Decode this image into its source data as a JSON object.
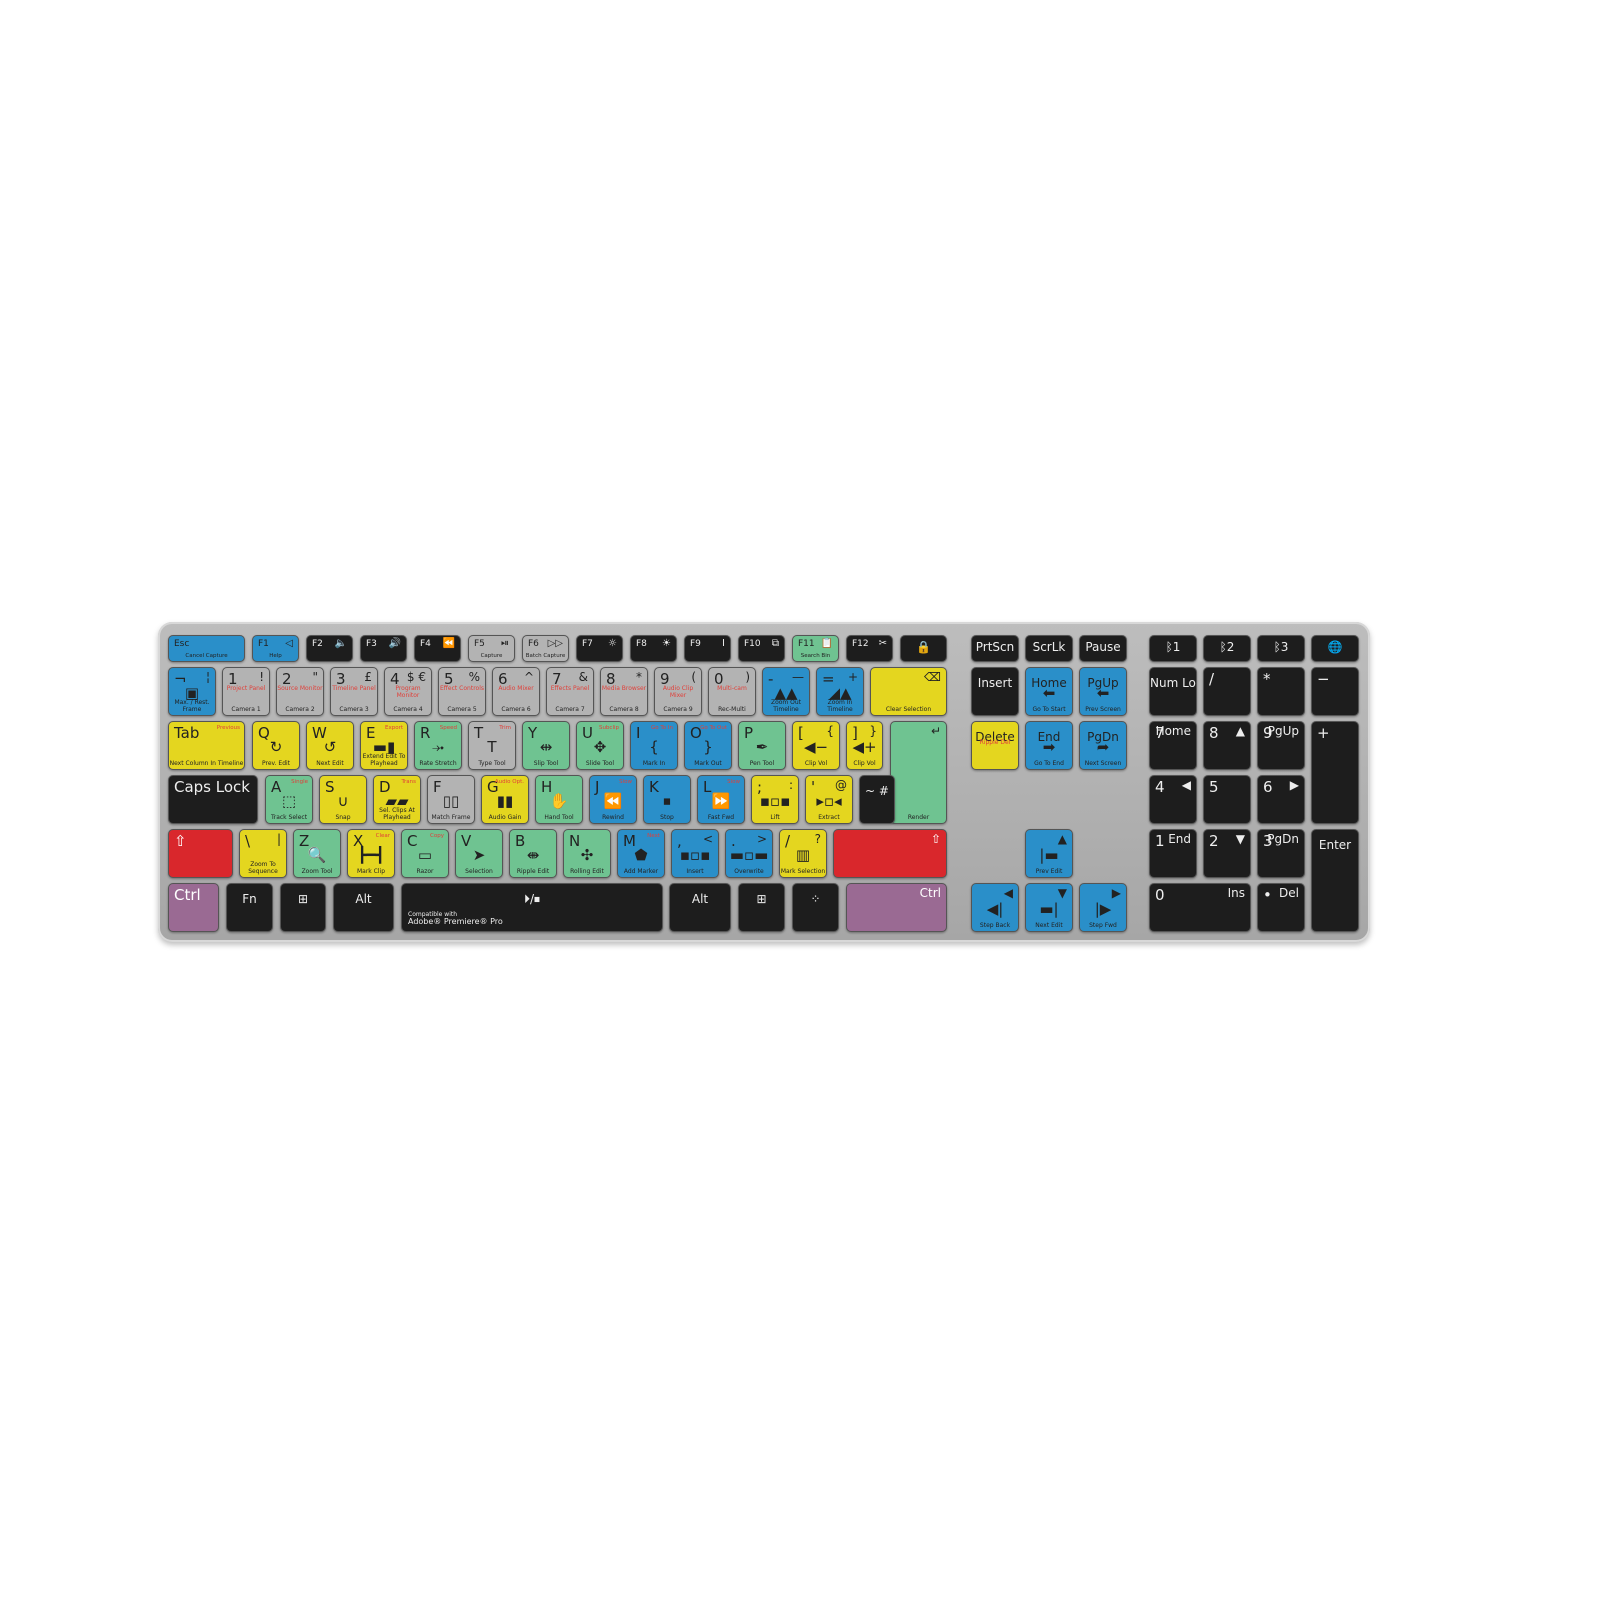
{
  "product": {
    "compat_line1": "Compatible with",
    "compat_line2": "Adobe® Premiere® Pro"
  },
  "colors": {
    "blue": "#2a8fc9",
    "yellow": "#e4d61f",
    "green": "#6fc391",
    "gray": "#b3b3b3",
    "black": "#1d1d1d",
    "red": "#d9272c",
    "purple": "#9a6a93",
    "sublabel": "#e0403a"
  },
  "keys": [
    {
      "t": "Esc",
      "b": "Cancel Capture",
      "c": "blue"
    },
    {
      "t": "F1",
      "s": "◁",
      "b": "Help",
      "c": "blue"
    },
    {
      "t": "F2",
      "s": "🔈",
      "c": "black"
    },
    {
      "t": "F3",
      "s": "🔊",
      "c": "black"
    },
    {
      "t": "F4",
      "s": "⏪",
      "c": "black"
    },
    {
      "t": "F5",
      "s": "⏯",
      "b": "Capture",
      "c": "gray"
    },
    {
      "t": "F6",
      "s": "▷▷",
      "b": "Batch Capture",
      "c": "gray"
    },
    {
      "t": "F7",
      "s": "☼",
      "c": "black"
    },
    {
      "t": "F8",
      "s": "☀",
      "c": "black"
    },
    {
      "t": "F9",
      "s": "I",
      "c": "black"
    },
    {
      "t": "F10",
      "s": "⧉",
      "c": "black"
    },
    {
      "t": "F11",
      "s": "📋",
      "b": "Search Bin",
      "c": "green"
    },
    {
      "t": "F12",
      "s": "✂",
      "c": "black"
    },
    {
      "t": "🔒",
      "c": "black",
      "center": true
    },
    {
      "t": "PrtScn",
      "c": "black",
      "center": true
    },
    {
      "t": "ScrLk",
      "c": "black",
      "center": true
    },
    {
      "t": "Pause",
      "c": "black",
      "center": true
    },
    {
      "t": "ᛒ1",
      "c": "black",
      "center": true
    },
    {
      "t": "ᛒ2",
      "c": "black",
      "center": true
    },
    {
      "t": "ᛒ3",
      "c": "black",
      "center": true
    },
    {
      "t": "🌐",
      "c": "black",
      "center": true
    },
    {
      "t": "¬",
      "s": "¦",
      "i": "▣",
      "b": "Max. / Rest. Frame",
      "c": "blue"
    },
    {
      "t": "1",
      "s": "!",
      "r": "Project Panel",
      "b": "Camera 1",
      "c": "gray"
    },
    {
      "t": "2",
      "s": "\"",
      "r": "Source Monitor",
      "b": "Camera 2",
      "c": "gray"
    },
    {
      "t": "3",
      "s": "£",
      "r": "Timeline Panel",
      "b": "Camera 3",
      "c": "gray"
    },
    {
      "t": "4",
      "s": "$ €",
      "r": "Program Monitor",
      "b": "Camera 4",
      "c": "gray"
    },
    {
      "t": "5",
      "s": "%",
      "r": "Effect Controls",
      "b": "Camera 5",
      "c": "gray"
    },
    {
      "t": "6",
      "s": "^",
      "r": "Audio Mixer",
      "b": "Camera 6",
      "c": "gray"
    },
    {
      "t": "7",
      "s": "&",
      "r": "Effects Panel",
      "b": "Camera 7",
      "c": "gray"
    },
    {
      "t": "8",
      "s": "*",
      "r": "Media Browser",
      "b": "Camera 8",
      "c": "gray"
    },
    {
      "t": "9",
      "s": "(",
      "r": "Audio Clip Mixer",
      "b": "Camera 9",
      "c": "gray"
    },
    {
      "t": "0",
      "s": ")",
      "r": "Multi-cam",
      "b": "Rec-Multi",
      "c": "gray"
    },
    {
      "t": "-",
      "s": "—",
      "i": "▲▲",
      "b": "Zoom Out Timeline",
      "c": "blue"
    },
    {
      "t": "=",
      "s": "+",
      "i": "◢▲",
      "b": "Zoom In Timeline",
      "c": "blue"
    },
    {
      "s": "⌫",
      "b": "Clear  Selection",
      "c": "yellow"
    },
    {
      "t": "Insert",
      "c": "black",
      "center": true
    },
    {
      "t": "Home",
      "i": "⬅",
      "b": "Go To Start",
      "c": "blue",
      "center": true
    },
    {
      "t": "PgUp",
      "i": "⬅",
      "b": "Prev Screen",
      "c": "blue",
      "center": true
    },
    {
      "t": "Num Lock",
      "c": "black",
      "center": true
    },
    {
      "t": "/",
      "c": "black"
    },
    {
      "t": "*",
      "c": "black"
    },
    {
      "t": "−",
      "c": "black"
    },
    {
      "t": "Tab",
      "rt": "Previous",
      "b": "Next Column In Timeline",
      "c": "yellow"
    },
    {
      "t": "Q",
      "i": "↻",
      "b": "Prev. Edit",
      "c": "yellow"
    },
    {
      "t": "W",
      "i": "↺",
      "b": "Next Edit",
      "c": "yellow"
    },
    {
      "t": "E",
      "rt": "Export",
      "i": "▬▮",
      "b": "Extend Edit To Playhead",
      "c": "yellow"
    },
    {
      "t": "R",
      "rt": "Speed",
      "i": "⤞",
      "b": "Rate Stretch",
      "c": "green"
    },
    {
      "t": "T",
      "rt": "Trim",
      "i": "T",
      "b": "Type Tool",
      "c": "gray"
    },
    {
      "t": "Y",
      "i": "⇹",
      "b": "Slip Tool",
      "c": "green"
    },
    {
      "t": "U",
      "rt": "Subclip",
      "i": "✥",
      "b": "Slide Tool",
      "c": "green"
    },
    {
      "t": "I",
      "rt": "Go To In",
      "i": "{",
      "b": "Mark In",
      "c": "blue"
    },
    {
      "t": "O",
      "rt": "Go To Out",
      "i": "}",
      "b": "Mark Out",
      "c": "blue"
    },
    {
      "t": "P",
      "i": "✒",
      "b": "Pen Tool",
      "c": "green"
    },
    {
      "t": "[",
      "s": "{",
      "i": "◀−",
      "b": "Clip Vol",
      "c": "yellow"
    },
    {
      "t": "]",
      "s": "}",
      "i": "◀+",
      "b": "Clip Vol",
      "c": "yellow"
    },
    {
      "s": "↵",
      "b": "Render",
      "c": "green"
    },
    {
      "t": "Delete",
      "r": "Ripple Del",
      "c": "yellow",
      "center": true
    },
    {
      "t": "End",
      "i": "➡",
      "b": "Go To End",
      "c": "blue",
      "center": true
    },
    {
      "t": "PgDn",
      "i": "➦",
      "b": "Next Screen",
      "c": "blue",
      "center": true
    },
    {
      "t": "7",
      "s": "Home",
      "c": "black"
    },
    {
      "t": "8",
      "s": "▲",
      "c": "black"
    },
    {
      "t": "9",
      "s": "PgUp",
      "c": "black"
    },
    {
      "t": "+",
      "c": "black"
    },
    {
      "t": "Caps Lock",
      "c": "black"
    },
    {
      "t": "A",
      "rt": "Single",
      "i": "⬚",
      "b": "Track Select",
      "c": "green"
    },
    {
      "t": "S",
      "i": "∪",
      "b": "Snap",
      "c": "yellow"
    },
    {
      "t": "D",
      "rt": "Trans",
      "i": "▰▰",
      "b": "Sel. Clips At Playhead",
      "c": "yellow"
    },
    {
      "t": "F",
      "i": "▯▯",
      "b": "Match Frame",
      "c": "gray"
    },
    {
      "t": "G",
      "rt": "Audio Opt.",
      "i": "▮▮",
      "b": "Audio Gain",
      "c": "yellow"
    },
    {
      "t": "H",
      "i": "✋",
      "b": "Hand Tool",
      "c": "green"
    },
    {
      "t": "J",
      "rt": "Slow",
      "i": "⏪",
      "b": "Rewind",
      "c": "blue"
    },
    {
      "t": "K",
      "i": "⏹",
      "b": "Stop",
      "c": "blue"
    },
    {
      "t": "L",
      "rt": "Slow",
      "i": "⏩",
      "b": "Fast Fwd",
      "c": "blue"
    },
    {
      "t": ";",
      "s": ":",
      "i": "▪▫▪",
      "b": "Lift",
      "c": "yellow"
    },
    {
      "t": "'",
      "s": "@",
      "i": "▸▫◂",
      "b": "Extract",
      "c": "yellow"
    },
    {
      "t": "~ #",
      "c": "black",
      "center": true
    },
    {
      "t": "4",
      "s": "◀",
      "c": "black"
    },
    {
      "t": "5",
      "c": "black"
    },
    {
      "t": "6",
      "s": "▶",
      "c": "black"
    },
    {
      "t": "⇧",
      "c": "red"
    },
    {
      "t": "\\",
      "s": "|",
      "b": "Zoom To Sequence",
      "c": "yellow"
    },
    {
      "t": "Z",
      "i": "🔍",
      "b": "Zoom Tool",
      "c": "green"
    },
    {
      "t": "X",
      "rt": "Clear",
      "i": "┣━┫",
      "b": "Mark Clip",
      "c": "yellow"
    },
    {
      "t": "C",
      "rt": "Copy",
      "i": "▭",
      "b": "Razor",
      "c": "green"
    },
    {
      "t": "V",
      "i": "➤",
      "b": "Selection",
      "c": "green"
    },
    {
      "t": "B",
      "i": "⇼",
      "b": "Ripple Edit",
      "c": "green"
    },
    {
      "t": "N",
      "i": "✣",
      "b": "Rolling Edit",
      "c": "green"
    },
    {
      "t": "M",
      "rt": "Next",
      "i": "⬟",
      "b": "Add Marker",
      "c": "blue"
    },
    {
      "t": ",",
      "s": "<",
      "i": "▪▫▪",
      "b": "Insert",
      "c": "blue"
    },
    {
      "t": ".",
      "s": ">",
      "i": "▬▫▬",
      "b": "Overwrite",
      "c": "blue"
    },
    {
      "t": "/",
      "s": "?",
      "i": "▥",
      "b": "Mark Selection",
      "c": "yellow"
    },
    {
      "s": "⇧",
      "c": "red"
    },
    {
      "s": "▲",
      "i": "|▬",
      "b": "Prev Edit",
      "c": "blue"
    },
    {
      "t": "1",
      "s": "End",
      "c": "black"
    },
    {
      "t": "2",
      "s": "▼",
      "c": "black"
    },
    {
      "t": "3",
      "s": "PgDn",
      "c": "black"
    },
    {
      "t": "Enter",
      "c": "black",
      "center": true
    },
    {
      "t": "Ctrl",
      "c": "purple"
    },
    {
      "t": "Fn",
      "c": "black",
      "center": true
    },
    {
      "t": "⊞",
      "c": "black",
      "center": true
    },
    {
      "t": "Alt",
      "c": "black",
      "center": true
    },
    {
      "t": "⏵/⏹",
      "c": "black",
      "center": true,
      "compat": true
    },
    {
      "t": "Alt",
      "c": "black",
      "center": true
    },
    {
      "t": "⊞",
      "c": "black",
      "center": true
    },
    {
      "t": "⁘",
      "c": "black",
      "center": true
    },
    {
      "s": "Ctrl",
      "c": "purple"
    },
    {
      "s": "◀",
      "i": "◀|",
      "b": "Step Back",
      "c": "blue"
    },
    {
      "s": "▼",
      "i": "▬|",
      "b": "Next Edit",
      "c": "blue"
    },
    {
      "s": "▶",
      "i": "|▶",
      "b": "Step Fwd",
      "c": "blue"
    },
    {
      "t": "0",
      "s": "Ins",
      "c": "black"
    },
    {
      "t": "•",
      "s": "Del",
      "c": "black"
    }
  ]
}
